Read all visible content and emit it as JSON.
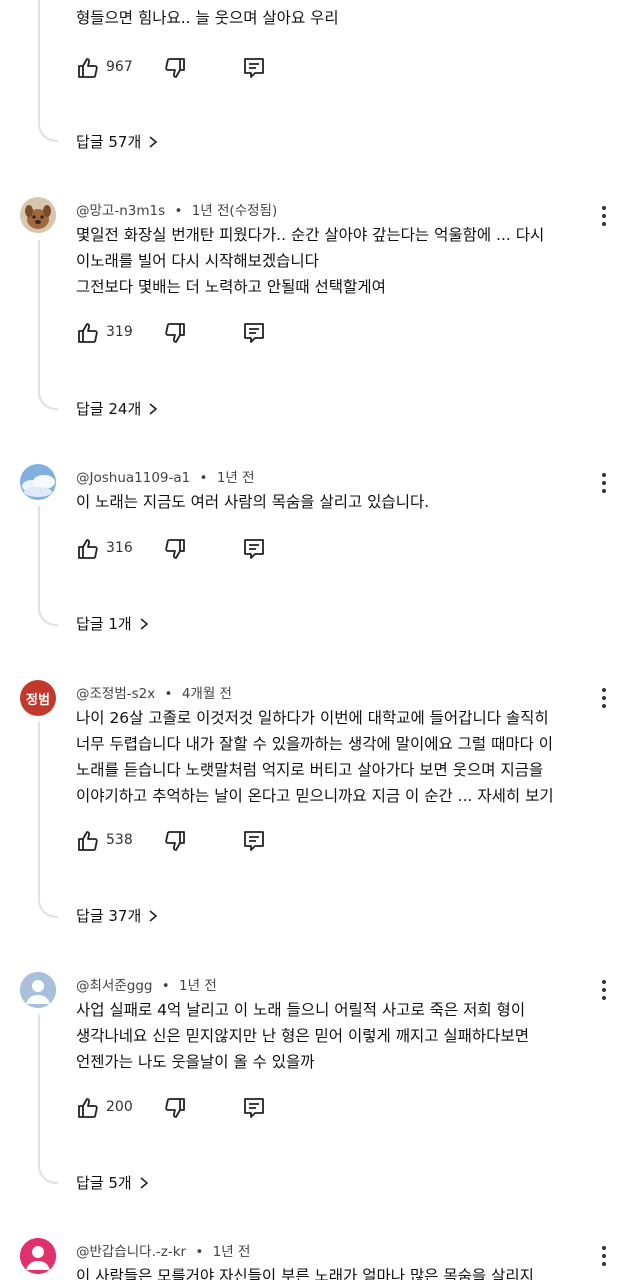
{
  "top": {
    "partial_text": "형들으면 힘나요.. 늘 웃으며 살아요 우리",
    "likes": "967",
    "replies": "답글 57개"
  },
  "comments": [
    {
      "author": "@망고-n3m1s",
      "time": "1년 전(수정됨)",
      "text": "몇일전 화장실 번개탄 피웠다가.. 순간 살아야 갚는다는 억울함에 ... 다시\n이노래를 빌어 다시 시작해보겠습니다\n그전보다 몇배는 더 노력하고 안될때 선택할게여",
      "likes": "319",
      "replies": "답글 24개"
    },
    {
      "author": "@Joshua1109-a1",
      "time": "1년 전",
      "text": "이 노래는 지금도 여러 사람의 목숨을 살리고 있습니다.",
      "likes": "316",
      "replies": "답글 1개"
    },
    {
      "author": "@조정범-s2x",
      "time": "4개월 전",
      "avatar_text": "정범",
      "text": "나이 26살 고졸로 이것저것 일하다가 이번에 대학교에 들어갑니다 솔직히\n너무 두렵습니다 내가 잘할 수 있을까하는 생각에 말이에요 그럴 때마다 이\n노래를 듣습니다 노랫말처럼 억지로 버티고 살아가다 보면 웃으며 지금을\n이야기하고 추억하는 날이 온다고 믿으니까요 지금 이 순간 ... 자세히 보기",
      "likes": "538",
      "replies": "답글 37개"
    },
    {
      "author": "@최서준ggg",
      "time": "1년 전",
      "text": "사업 실패로 4억 날리고 이 노래 들으니 어릴적 사고로 죽은 저희 형이\n생각나네요 신은 믿지않지만 난 형은 믿어 이렇게 깨지고 실패하다보면\n언젠가는 나도 웃을날이 올 수 있을까",
      "likes": "200",
      "replies": "답글 5개"
    },
    {
      "author": "@반갑습니다.-z-kr",
      "time": "1년 전",
      "text": "이 사람들은 모를거야 자신들이 부른 노래가 얼마나 많은 목숨을 살리지"
    }
  ],
  "separator": "•",
  "colors": {
    "red_avatar": "#c0392b",
    "pink_avatar": "#e0306e",
    "thread": "#e0e0e0"
  }
}
